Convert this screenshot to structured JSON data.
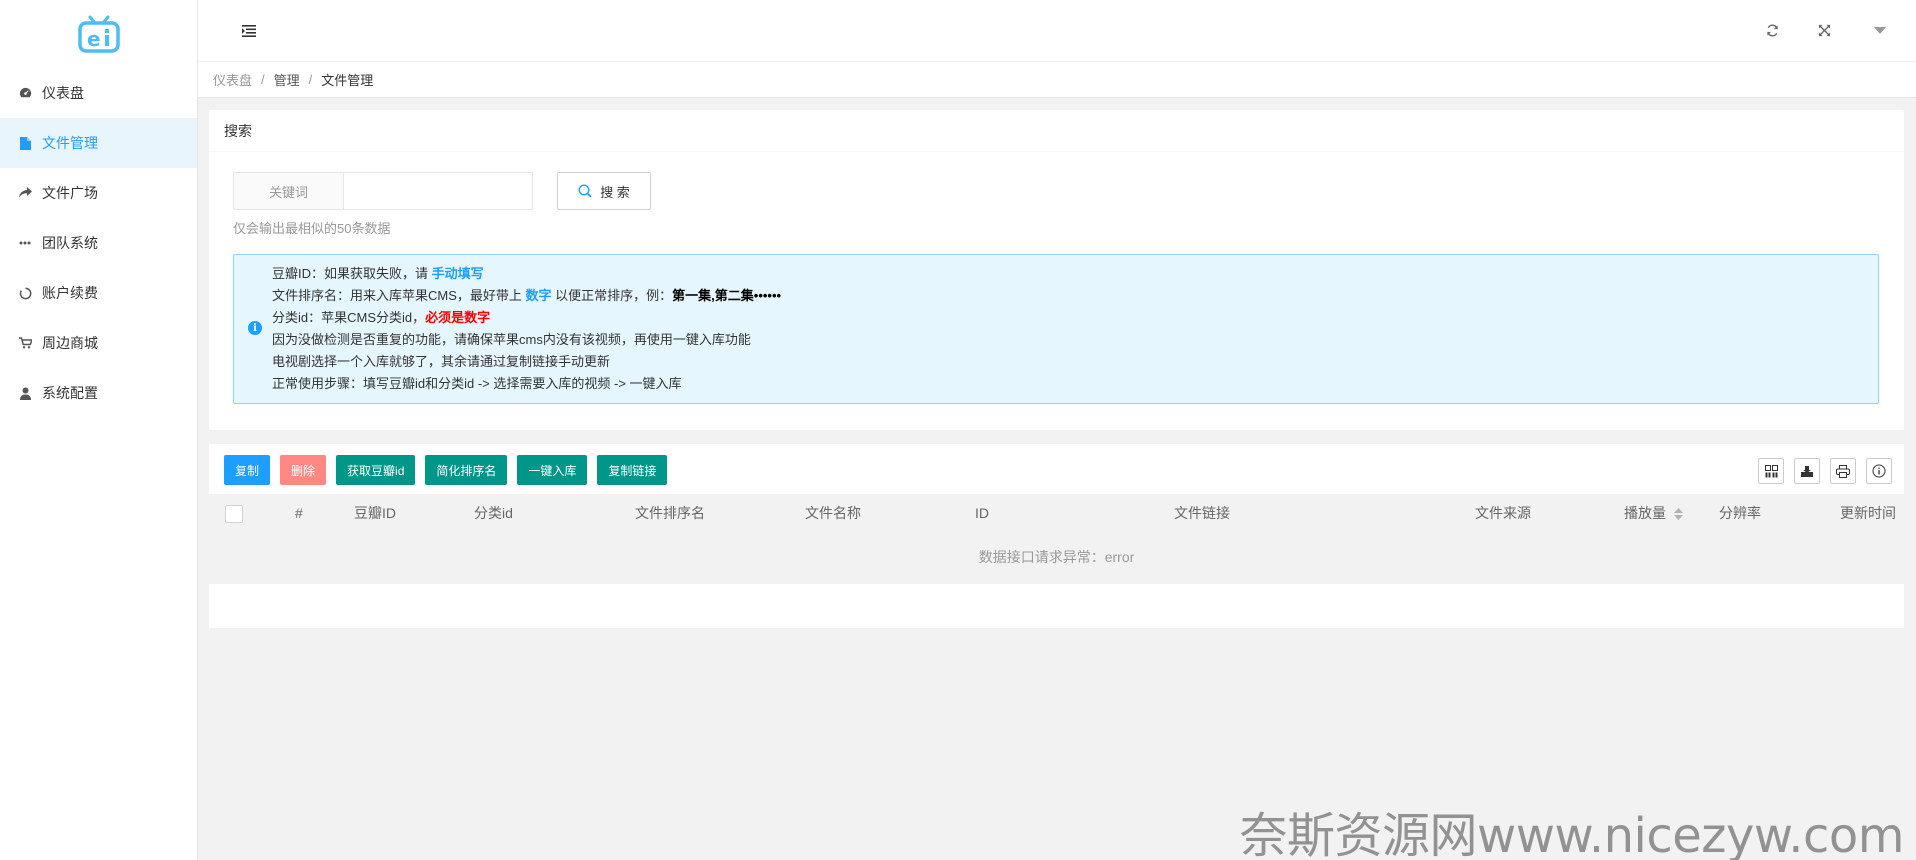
{
  "sidebar": {
    "logo_icon": "tv-logo-icon",
    "items": [
      {
        "label": "仪表盘",
        "icon": "dashboard-icon",
        "active": false
      },
      {
        "label": "文件管理",
        "icon": "file-icon",
        "active": true
      },
      {
        "label": "文件广场",
        "icon": "share-icon",
        "active": false
      },
      {
        "label": "团队系统",
        "icon": "more-icon",
        "active": false
      },
      {
        "label": "账户续费",
        "icon": "circle-icon",
        "active": false
      },
      {
        "label": "周边商城",
        "icon": "cart-icon",
        "active": false
      },
      {
        "label": "系统配置",
        "icon": "user-icon",
        "active": false
      }
    ]
  },
  "header": {
    "icons": [
      "menu-fold-icon",
      "refresh-icon",
      "fullscreen-icon",
      "caret-down-icon"
    ]
  },
  "breadcrumb": {
    "items": [
      "仪表盘",
      "管理",
      "文件管理"
    ],
    "separator": "/"
  },
  "search_card": {
    "title": "搜索",
    "keyword_label": "关键词",
    "keyword_value": "",
    "keyword_placeholder": "",
    "search_button": "搜 索",
    "hint": "仅会输出最相似的50条数据",
    "tips": {
      "l1_prefix": "豆瓣ID：如果获取失败，请 ",
      "l1_link": "手动填写",
      "l2_prefix": "文件排序名：用来入库苹果CMS，最好带上 ",
      "l2_link": "数字",
      "l2_mid": " 以便正常排序，例：",
      "l2_bold": "第一集,第二集••••••",
      "l3_prefix": "分类id：苹果CMS分类id，",
      "l3_red": "必须是数字",
      "l4": "因为没做检测是否重复的功能，请确保苹果cms内没有该视频，再使用一键入库功能",
      "l5": "电视剧选择一个入库就够了，其余请通过复制链接手动更新",
      "l6": "正常使用步骤：填写豆瓣id和分类id -> 选择需要入库的视频 -> 一键入库"
    }
  },
  "table": {
    "buttons": {
      "copy": "复制",
      "delete": "删除",
      "get_douban": "获取豆瓣id",
      "simplify": "简化排序名",
      "import": "一键入库",
      "copy_link": "复制链接"
    },
    "tool_icons": [
      "columns-icon",
      "export-icon",
      "print-icon",
      "info-icon"
    ],
    "columns": [
      "#",
      "豆瓣ID",
      "分类id",
      "文件排序名",
      "文件名称",
      "ID",
      "文件链接",
      "文件来源",
      "播放量",
      "分辨率",
      "更新时间"
    ],
    "empty_text": "数据接口请求异常：error"
  },
  "watermark": "奈斯资源网www.nicezyw.com",
  "colors": {
    "primary": "#1e9fff",
    "green": "#009688",
    "danger": "#ff8884",
    "tip_bg": "#e6f6fe",
    "tip_border": "#91d5f8"
  }
}
